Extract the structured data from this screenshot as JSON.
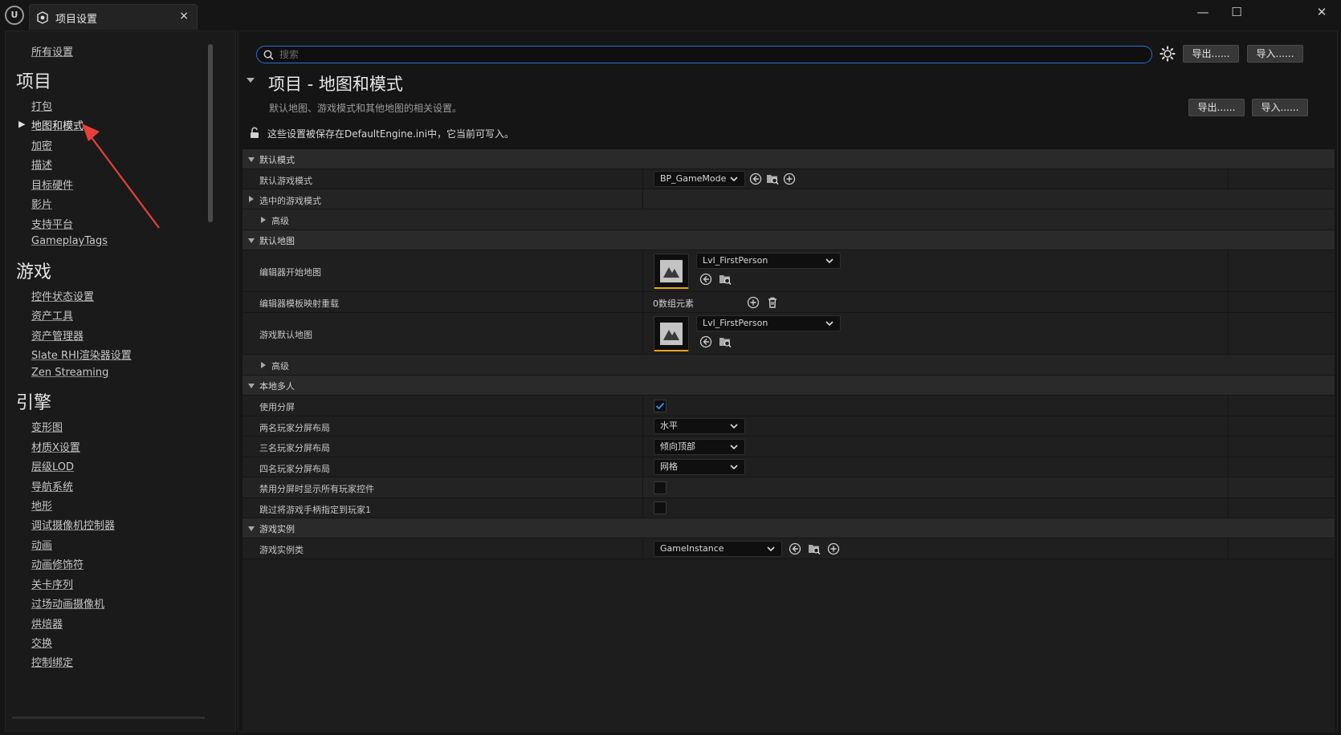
{
  "window": {
    "tab_title": "项目设置",
    "tab_close": "×",
    "controls": {
      "minimize": "—",
      "maximize": "☐",
      "close": "✕"
    }
  },
  "sidebar": {
    "all_settings": "所有设置",
    "sections": [
      {
        "heading": "项目",
        "items": [
          "打包",
          "地图和模式",
          "加密",
          "描述",
          "目标硬件",
          "影片",
          "支持平台",
          "GameplayTags"
        ]
      },
      {
        "heading": "游戏",
        "items": [
          "控件状态设置",
          "资产工具",
          "资产管理器",
          "Slate RHI渲染器设置",
          "Zen Streaming"
        ]
      },
      {
        "heading": "引擎",
        "items": [
          "变形图",
          "材质X设置",
          "层级LOD",
          "导航系统",
          "地形",
          "调试摄像机控制器",
          "动画",
          "动画修饰符",
          "关卡序列",
          "过场动画摄像机",
          "烘焙器",
          "交换",
          "控制绑定"
        ]
      }
    ],
    "selected_item": "地图和模式"
  },
  "toolbar": {
    "search_placeholder": "搜索",
    "export_label": "导出......",
    "import_label": "导入......"
  },
  "page": {
    "title": "项目 - 地图和模式",
    "description": "默认地图、游戏模式和其他地图的相关设置。",
    "export_label": "导出......",
    "import_label": "导入......",
    "lock_note": "这些设置被保存在DefaultEngine.ini中，它当前可写入。"
  },
  "grid": {
    "default_modes": {
      "label": "默认模式",
      "default_game_mode_label": "默认游戏模式",
      "default_game_mode_value": "BP_GameMode",
      "selected_game_mode_label": "选中的游戏模式",
      "advanced_label": "高级"
    },
    "default_maps": {
      "label": "默认地图",
      "editor_startup_map_label": "编辑器开始地图",
      "editor_startup_map_value": "Lvl_FirstPerson",
      "editor_template_map_label": "编辑器模板映射重载",
      "editor_template_map_value": "0数组元素",
      "game_default_map_label": "游戏默认地图",
      "game_default_map_value": "Lvl_FirstPerson",
      "advanced_label": "高级"
    },
    "local_multiplayer": {
      "label": "本地多人",
      "use_splitscreen_label": "使用分屏",
      "use_splitscreen_checked": true,
      "two_player_label": "两名玩家分屏布局",
      "two_player_value": "水平",
      "three_player_label": "三名玩家分屏布局",
      "three_player_value": "倾向顶部",
      "four_player_label": "四名玩家分屏布局",
      "four_player_value": "网格",
      "disable_splitscreen_label": "禁用分屏时显示所有玩家控件",
      "disable_splitscreen_checked": false,
      "skip_controller_label": "跳过将游戏手柄指定到玩家1",
      "skip_controller_checked": false
    },
    "game_instance": {
      "label": "游戏实例",
      "class_label": "游戏实例类",
      "class_value": "GameInstance"
    }
  },
  "colors": {
    "accent_blue": "#2a6fd6",
    "asset_orange": "#e8a21a",
    "annotation_red": "#e8403a"
  }
}
